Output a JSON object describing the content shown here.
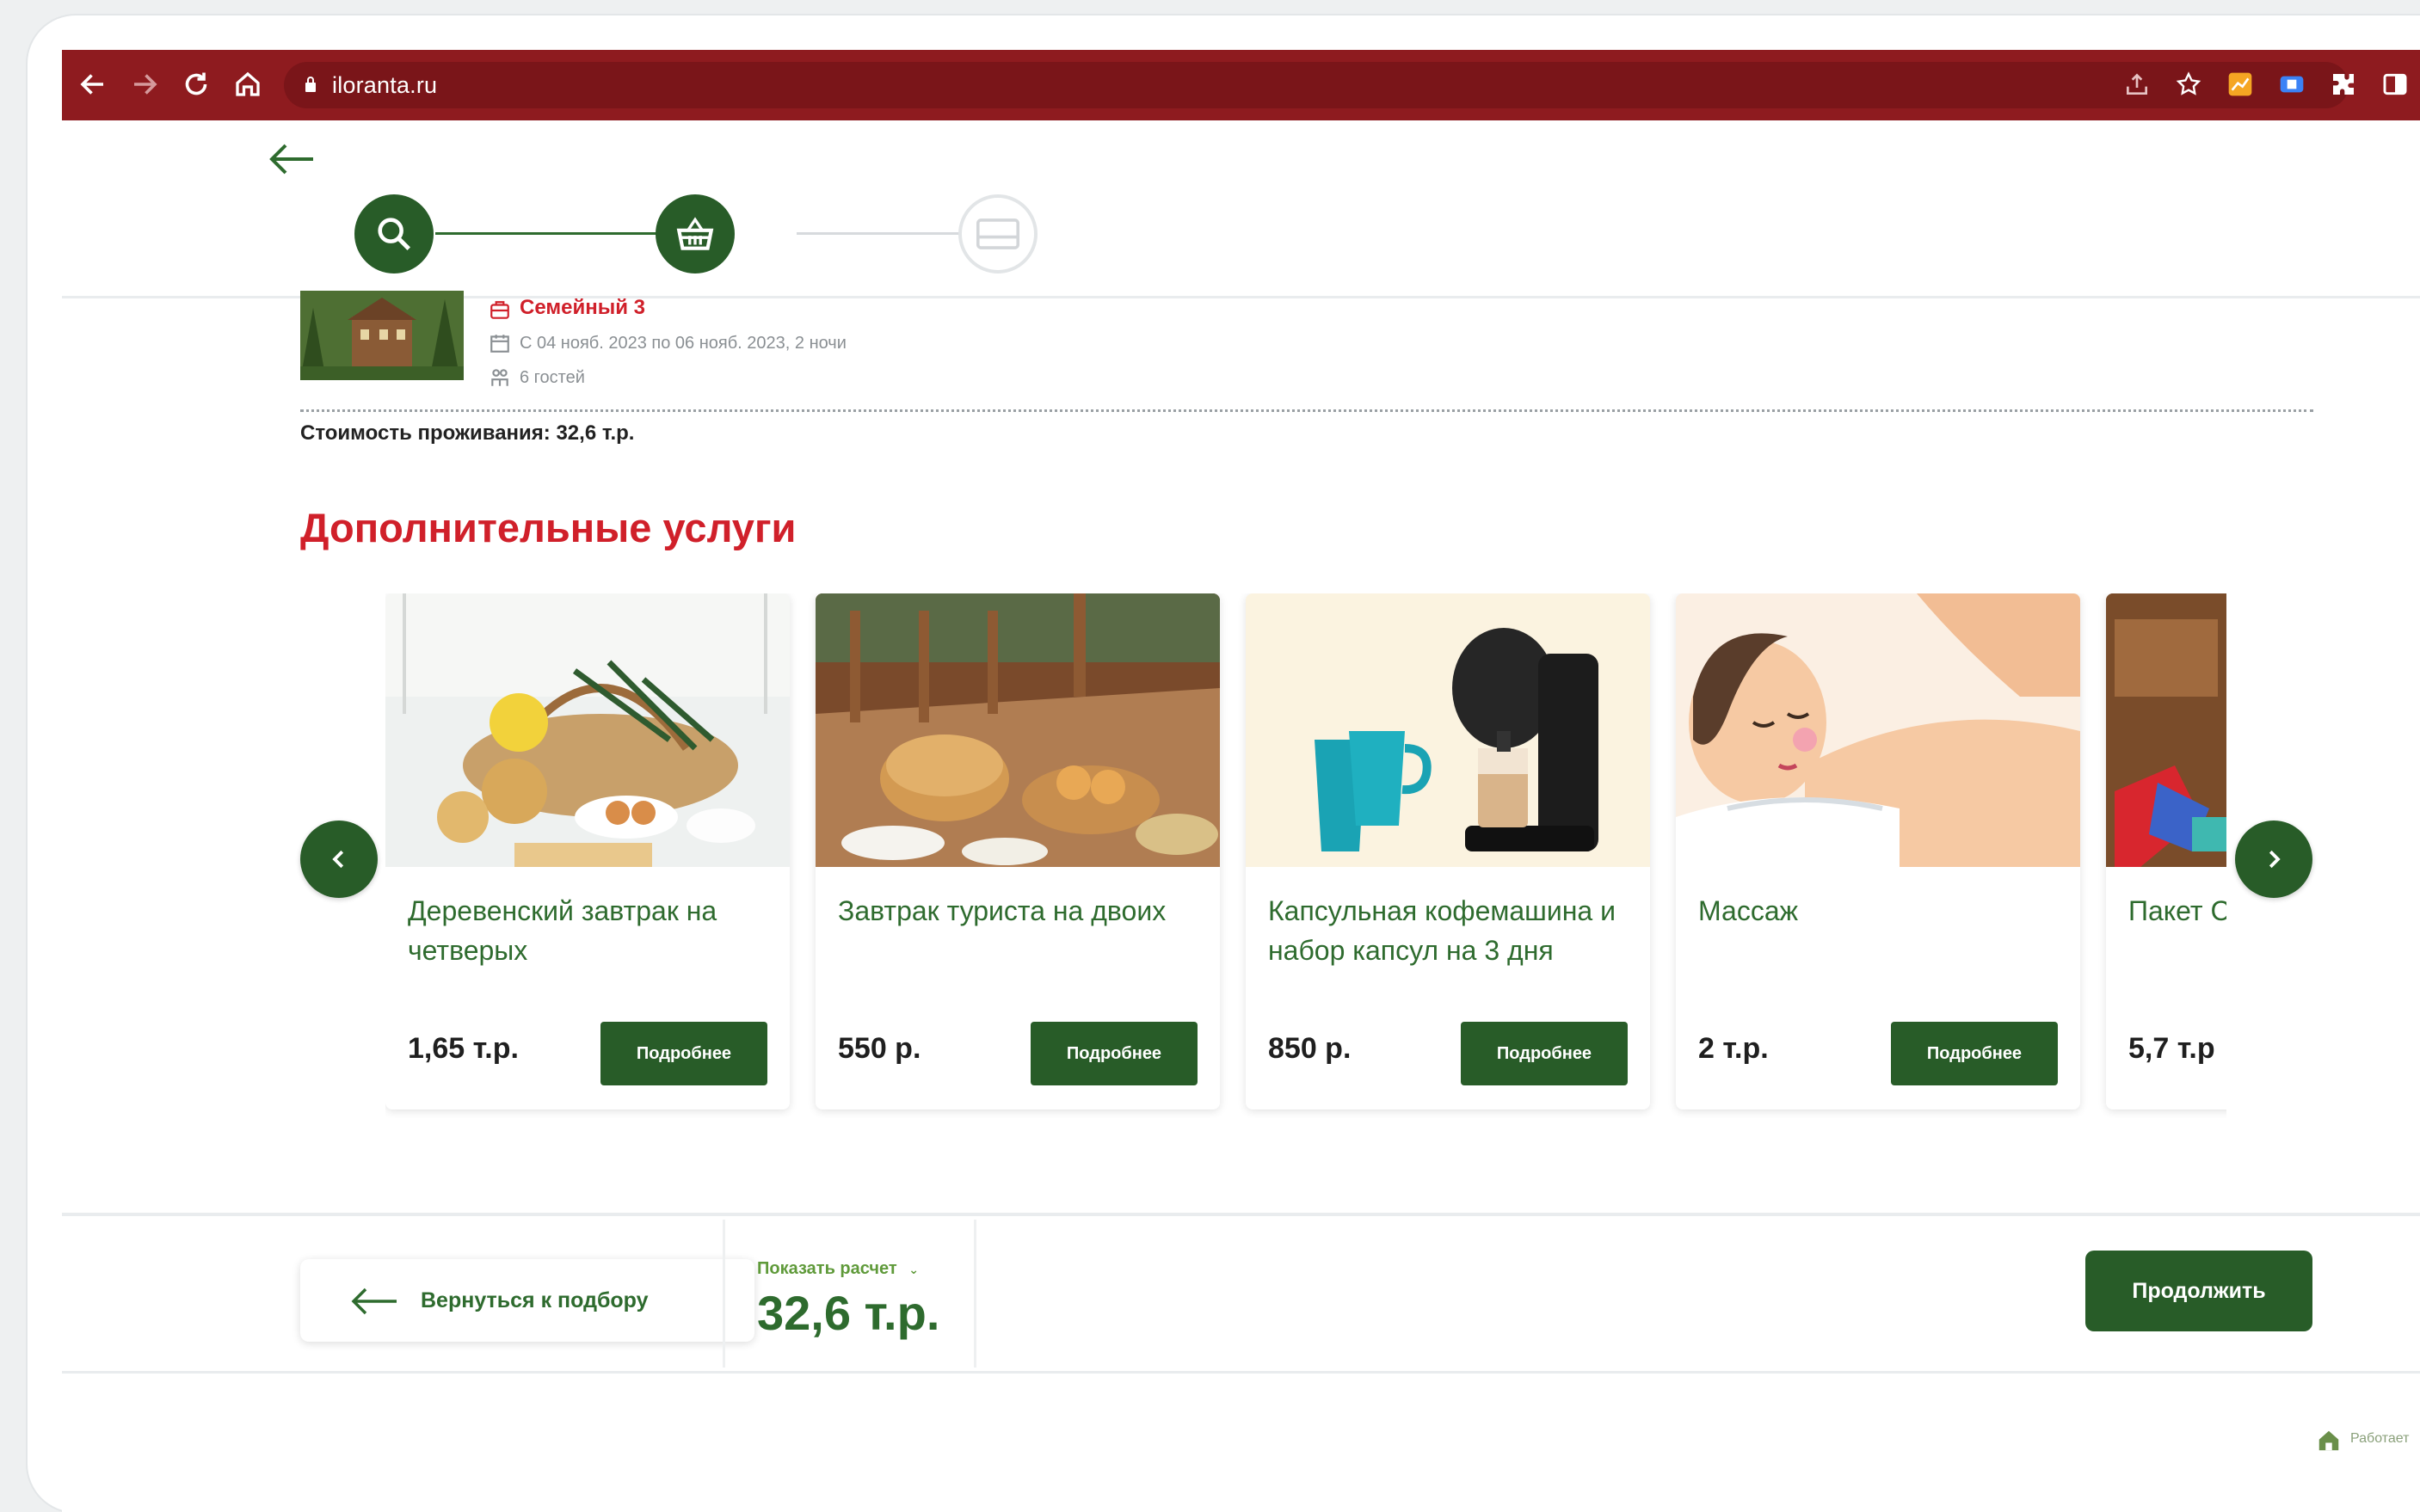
{
  "browser": {
    "url": "iloranta.ru"
  },
  "stepper": {
    "steps": [
      {
        "name": "search",
        "icon": "search-icon",
        "state": "done"
      },
      {
        "name": "basket",
        "icon": "basket-icon",
        "state": "active"
      },
      {
        "name": "payment",
        "icon": "card-icon",
        "state": "inactive"
      }
    ]
  },
  "booking": {
    "room_name": "Семейный 3",
    "dates": "С 04 нояб. 2023 по 06 нояб. 2023, 2 ночи",
    "guests": "6 гостей",
    "stay_cost": "Стоимость проживания: 32,6 т.р."
  },
  "services": {
    "title": "Дополнительные услуги",
    "more_label": "Подробнее",
    "items": [
      {
        "title": "Деревенский завтрак на четверых",
        "price": "1,65 т.р."
      },
      {
        "title": "Завтрак туриста на двоих",
        "price": "550 р."
      },
      {
        "title": "Капсульная кофемашина и набор капсул на 3 дня",
        "price": "850 р."
      },
      {
        "title": "Массаж",
        "price": "2 т.р."
      },
      {
        "title": "Пакет Семей",
        "price": "5,7 т.р"
      }
    ]
  },
  "footer": {
    "back_label": "Вернуться к подбору",
    "show_calc": "Показать расчет",
    "total": "32,6 т.р.",
    "continue_label": "Продолжить",
    "powered": "Работает"
  },
  "colors": {
    "browser_bar": "#8e1b1f",
    "accent_red": "#d0202a",
    "accent_green": "#285c28"
  }
}
